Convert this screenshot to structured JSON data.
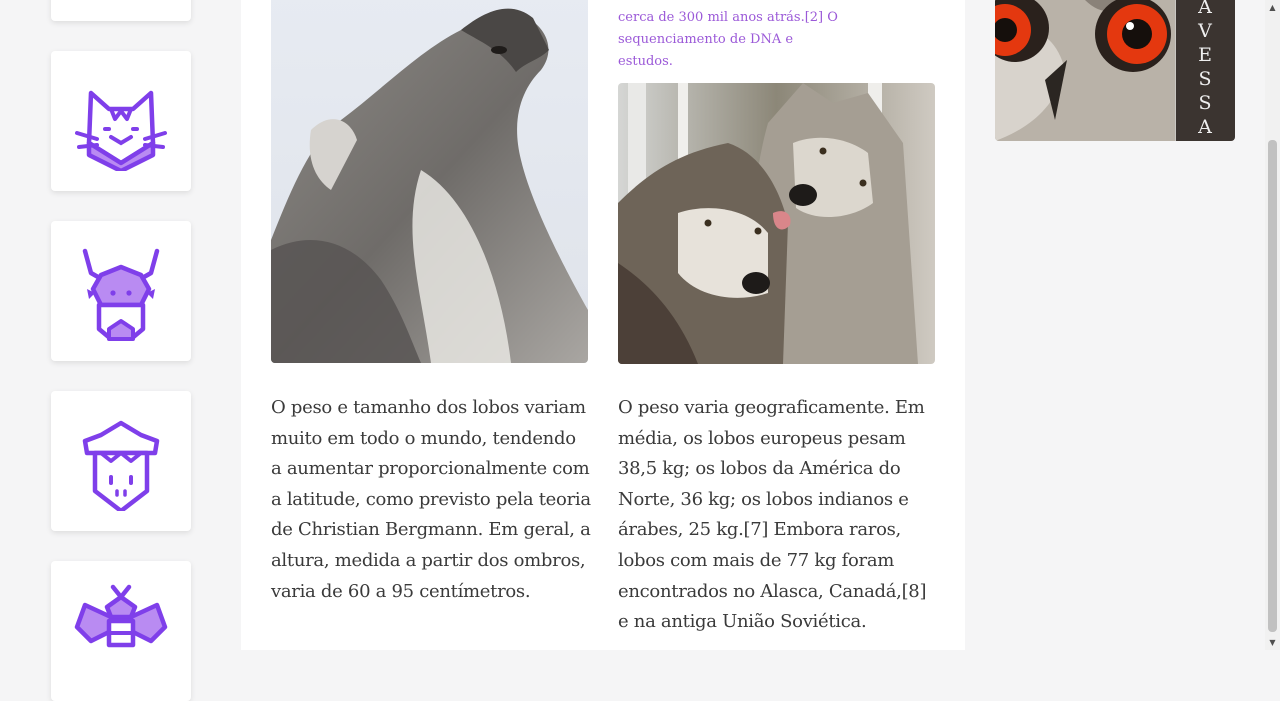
{
  "sidebar": {
    "items": [
      {
        "icon": "chevron-icon"
      },
      {
        "icon": "cat-icon"
      },
      {
        "icon": "bull-icon"
      },
      {
        "icon": "sheep-icon"
      },
      {
        "icon": "bee-icon"
      }
    ]
  },
  "article": {
    "caption_top": "cerca de 300 mil anos atrás.[2] O sequenciamento de DNA e estudos.",
    "photo_left": "howling-wolf",
    "photo_right": "two-wolves",
    "paragraph_left": "O peso e tamanho dos lobos variam muito em todo o mundo, tendendo a aumentar proporcionalmente com a latitude, como previsto pela teoria de Christian Bergmann. Em geral, a altura, medida a partir dos ombros, varia de 60 a 95 centímetros.",
    "paragraph_right": "O peso varia geograficamente. Em média, os lobos europeus pesam 38,5 kg; os lobos da América do Norte, 36 kg; os lobos indianos e árabes, 25 kg.[7] Embora raros, lobos com mais de 77 kg foram encontrados no Alasca, Canadá,[8] e na antiga União Soviética."
  },
  "ad": {
    "letters": [
      "A",
      "V",
      "E",
      "S",
      "S",
      "A"
    ]
  },
  "colors": {
    "accent": "#9b59d8",
    "icon_stroke": "#7f3fea",
    "icon_fill": "#b98bf2",
    "text": "#3a3a3a"
  }
}
